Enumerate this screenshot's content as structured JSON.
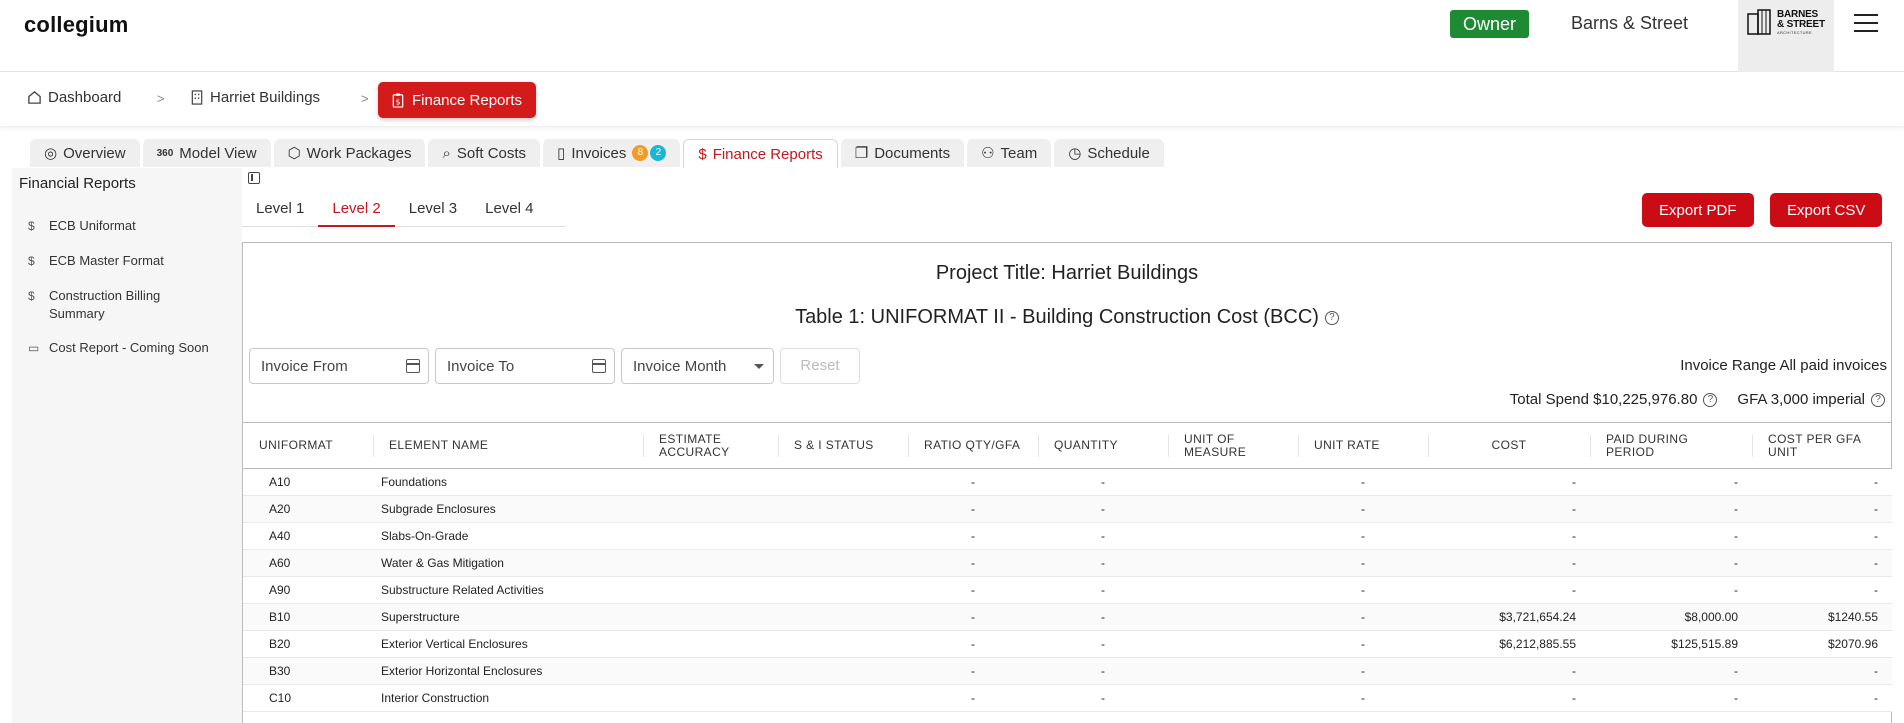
{
  "app": {
    "logo": "collegium"
  },
  "header": {
    "role_badge": "Owner",
    "company": "Barns & Street",
    "company_logo_line1": "BARNES",
    "company_logo_line2": "& STREET",
    "company_logo_sub": "ARCHITECTURE"
  },
  "breadcrumb": {
    "items": [
      "Dashboard",
      "Harriet Buildings"
    ],
    "separator": ">",
    "active": "Finance Reports"
  },
  "tabs": [
    {
      "label": "Overview",
      "icon": "overview-icon"
    },
    {
      "label": "Model View",
      "icon": "360-icon"
    },
    {
      "label": "Work Packages",
      "icon": "cube-icon"
    },
    {
      "label": "Soft Costs",
      "icon": "search-dollar-icon"
    },
    {
      "label": "Invoices",
      "icon": "document-icon",
      "badges": [
        "8",
        "2"
      ]
    },
    {
      "label": "Finance Reports",
      "icon": "dollar-icon"
    },
    {
      "label": "Documents",
      "icon": "documents-icon"
    },
    {
      "label": "Team",
      "icon": "team-icon"
    },
    {
      "label": "Schedule",
      "icon": "clock-icon"
    }
  ],
  "sidebar": {
    "title": "Financial Reports",
    "items": [
      {
        "label": "ECB Uniformat",
        "icon": "$"
      },
      {
        "label": "ECB Master Format",
        "icon": "$"
      },
      {
        "label": "Construction Billing Summary",
        "icon": "$"
      },
      {
        "label": "Cost Report - Coming Soon",
        "icon": "▭"
      }
    ]
  },
  "levels": [
    "Level 1",
    "Level 2",
    "Level 3",
    "Level 4"
  ],
  "actions": {
    "export_pdf": "Export PDF",
    "export_csv": "Export CSV"
  },
  "report": {
    "project_title": "Project Title: Harriet Buildings",
    "table_title": "Table 1: UNIFORMAT II - Building Construction Cost (BCC)",
    "filters": {
      "invoice_from": "Invoice From",
      "invoice_to": "Invoice To",
      "invoice_month": "Invoice Month",
      "reset": "Reset"
    },
    "invoice_range": "Invoice Range All paid invoices",
    "total_spend": "Total Spend $10,225,976.80",
    "gfa": "GFA 3,000 imperial",
    "columns": [
      "UNIFORMAT",
      "ELEMENT NAME",
      "ESTIMATE ACCURACY",
      "S & I STATUS",
      "RATIO QTY/GFA",
      "QUANTITY",
      "UNIT OF MEASURE",
      "UNIT RATE",
      "COST",
      "PAID DURING PERIOD",
      "COST PER GFA UNIT"
    ],
    "rows": [
      [
        "A10",
        "Foundations",
        "",
        "",
        "-",
        "-",
        "",
        "-",
        "-",
        "-",
        "-"
      ],
      [
        "A20",
        "Subgrade Enclosures",
        "",
        "",
        "-",
        "-",
        "",
        "-",
        "-",
        "-",
        "-"
      ],
      [
        "A40",
        "Slabs-On-Grade",
        "",
        "",
        "-",
        "-",
        "",
        "-",
        "-",
        "-",
        "-"
      ],
      [
        "A60",
        "Water & Gas Mitigation",
        "",
        "",
        "-",
        "-",
        "",
        "-",
        "-",
        "-",
        "-"
      ],
      [
        "A90",
        "Substructure Related Activities",
        "",
        "",
        "-",
        "-",
        "",
        "-",
        "-",
        "-",
        "-"
      ],
      [
        "B10",
        "Superstructure",
        "",
        "",
        "-",
        "-",
        "",
        "-",
        "$3,721,654.24",
        "$8,000.00",
        "$1240.55"
      ],
      [
        "B20",
        "Exterior Vertical Enclosures",
        "",
        "",
        "-",
        "-",
        "",
        "-",
        "$6,212,885.55",
        "$125,515.89",
        "$2070.96"
      ],
      [
        "B30",
        "Exterior Horizontal Enclosures",
        "",
        "",
        "-",
        "-",
        "",
        "-",
        "-",
        "-",
        "-"
      ],
      [
        "C10",
        "Interior Construction",
        "",
        "",
        "-",
        "-",
        "",
        "-",
        "-",
        "-",
        "-"
      ]
    ]
  }
}
